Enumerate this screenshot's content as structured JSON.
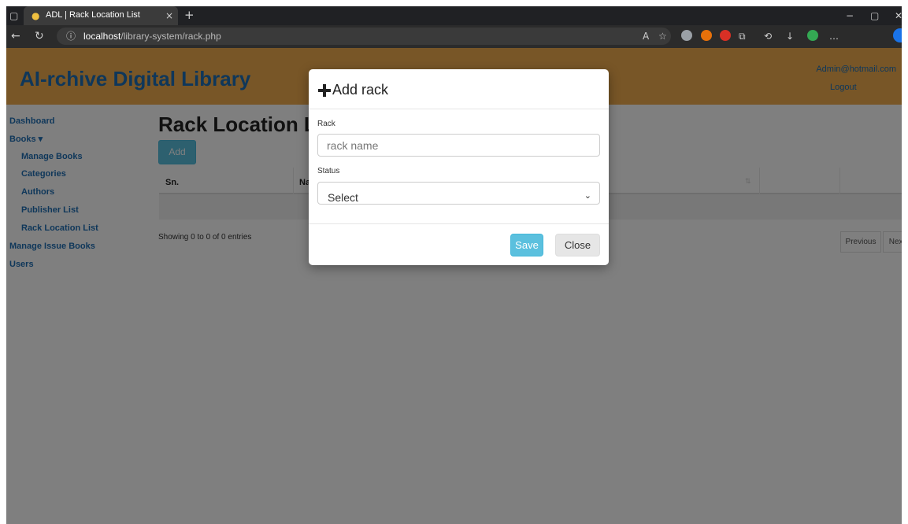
{
  "browser": {
    "tab_title": "ADL | Rack Location List",
    "tab_close": "×",
    "new_tab": "+",
    "url_host": "localhost",
    "url_path": "/library-system/rack.php",
    "window_controls": {
      "minimize": "−",
      "maximize": "▢",
      "close": "✕"
    }
  },
  "header": {
    "brand": "AI-rchive Digital Library",
    "user_email": "Admin@hotmail.com",
    "logout": "Logout"
  },
  "sidebar": {
    "items": [
      {
        "label": "Dashboard"
      },
      {
        "label": "Books ▾"
      },
      {
        "label": "Manage Books"
      },
      {
        "label": "Categories"
      },
      {
        "label": "Authors"
      },
      {
        "label": "Publisher List"
      },
      {
        "label": "Rack Location List"
      },
      {
        "label": "Manage Issue Books"
      },
      {
        "label": "Users"
      }
    ]
  },
  "main": {
    "title": "Rack Location Lis",
    "add_button": "Add",
    "table": {
      "columns": [
        "Sn.",
        "Na"
      ]
    },
    "info": "Showing 0 to 0 of 0 entries",
    "pagination": {
      "previous": "Previous",
      "next": "Next"
    }
  },
  "modal": {
    "title": "Add rack",
    "rack_label": "Rack",
    "rack_placeholder": "rack name",
    "status_label": "Status",
    "status_selected": "Select",
    "save": "Save",
    "close": "Close"
  },
  "colors": {
    "header_bg": "#f0ad4e",
    "link": "#1f6fb5",
    "button_info": "#5bc0de"
  }
}
